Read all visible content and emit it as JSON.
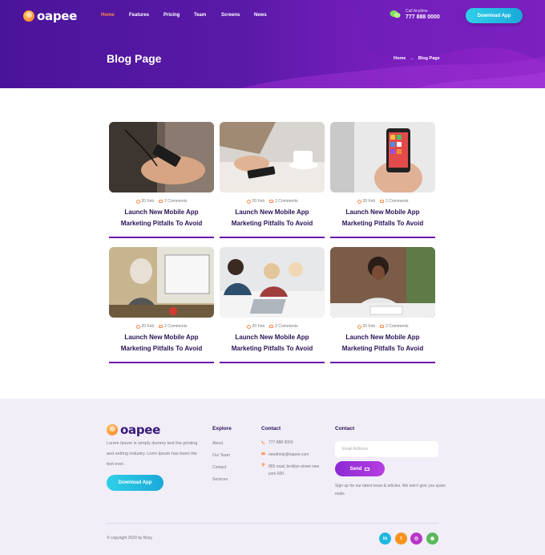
{
  "header": {
    "logo_text": "oapee",
    "nav": [
      {
        "label": "Home",
        "active": true
      },
      {
        "label": "Features",
        "active": false
      },
      {
        "label": "Pricing",
        "active": false
      },
      {
        "label": "Team",
        "active": false
      },
      {
        "label": "Screens",
        "active": false
      },
      {
        "label": "News",
        "active": false
      }
    ],
    "call_label": "Call Anytime",
    "call_number": "777 888 0000",
    "download_label": "Download App",
    "page_title": "Blog Page",
    "breadcrumb": {
      "home": "Home",
      "separator": "→",
      "current": "Blog Page"
    }
  },
  "posts": [
    {
      "date": "20 Feb",
      "comments": "2 Comments",
      "title_line1": "Launch New Mobile App",
      "title_line2": "Marketing Pitfalls To Avoid",
      "image": "hand-with-phone-and-earphones"
    },
    {
      "date": "20 Feb",
      "comments": "2 Comments",
      "title_line1": "Launch New Mobile App",
      "title_line2": "Marketing Pitfalls To Avoid",
      "image": "phone-on-table-with-coffee"
    },
    {
      "date": "20 Feb",
      "comments": "2 Comments",
      "title_line1": "Launch New Mobile App",
      "title_line2": "Marketing Pitfalls To Avoid",
      "image": "hand-holding-smartphone"
    },
    {
      "date": "20 Feb",
      "comments": "2 Comments",
      "title_line1": "Launch New Mobile App",
      "title_line2": "Marketing Pitfalls To Avoid",
      "image": "woman-with-headphones-at-computer"
    },
    {
      "date": "20 Feb",
      "comments": "2 Comments",
      "title_line1": "Launch New Mobile App",
      "title_line2": "Marketing Pitfalls To Avoid",
      "image": "team-meeting-with-laptops"
    },
    {
      "date": "20 Feb",
      "comments": "2 Comments",
      "title_line1": "Launch New Mobile App",
      "title_line2": "Marketing Pitfalls To Avoid",
      "image": "woman-writing-at-desk"
    }
  ],
  "footer": {
    "logo_text": "oapee",
    "description": "Lorem Ipsum is simply dummy text the printing and setting industry. Lorm Ipsum has been the text ever.",
    "download_label": "Download App",
    "explore_heading": "Explore",
    "explore_links": [
      "About",
      "Our Team",
      "Contact",
      "Services"
    ],
    "contact_heading": "Contact",
    "phone": "777 888 0000",
    "email": "needhelp@oapee.com",
    "address": "855 road, broklyn street new york 600",
    "newsletter_heading": "Contact",
    "email_placeholder": "Email Address",
    "send_label": "Send",
    "newsletter_note": "Sign up for our latest news & articles. We won't give you spam mails.",
    "copyright": "© copyright 2020 by Brizy",
    "socials": [
      {
        "name": "linkedin-icon",
        "glyph": "in",
        "color": "#1fb6e0"
      },
      {
        "name": "twitter-icon",
        "glyph": "t",
        "color": "#f6941d"
      },
      {
        "name": "instagram-icon",
        "glyph": "◎",
        "color": "#b736c9"
      },
      {
        "name": "dribbble-icon",
        "glyph": "◉",
        "color": "#5cb85c"
      }
    ]
  },
  "colors": {
    "brand_purple": "#5a1aa8",
    "accent_orange": "#ff8a47",
    "button_cyan": "#1fb6e0",
    "title_navy": "#2a1256"
  }
}
